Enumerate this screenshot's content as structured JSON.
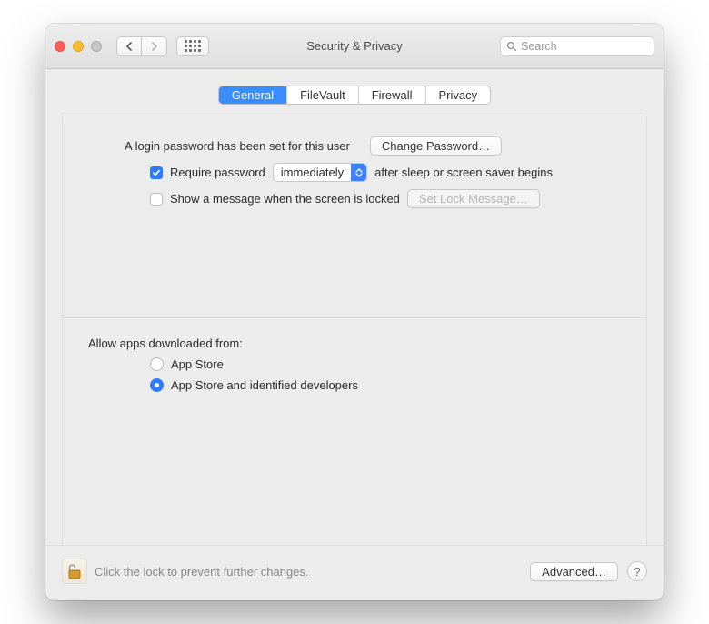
{
  "window": {
    "title": "Security & Privacy"
  },
  "search": {
    "placeholder": "Search"
  },
  "tabs": {
    "general": "General",
    "filevault": "FileVault",
    "firewall": "Firewall",
    "privacy": "Privacy",
    "active": "general"
  },
  "login": {
    "password_set_text": "A login password has been set for this user",
    "change_password_btn": "Change Password…",
    "require_password_label": "Require password",
    "require_password_checked": true,
    "delay_select": "immediately",
    "after_sleep_text": "after sleep or screen saver begins",
    "show_message_label": "Show a message when the screen is locked",
    "show_message_checked": false,
    "set_lock_message_btn": "Set Lock Message…"
  },
  "downloads": {
    "heading": "Allow apps downloaded from:",
    "option_appstore": "App Store",
    "option_identified": "App Store and identified developers",
    "selected": "identified"
  },
  "footer": {
    "lock_text": "Click the lock to prevent further changes.",
    "advanced_btn": "Advanced…",
    "help": "?"
  }
}
